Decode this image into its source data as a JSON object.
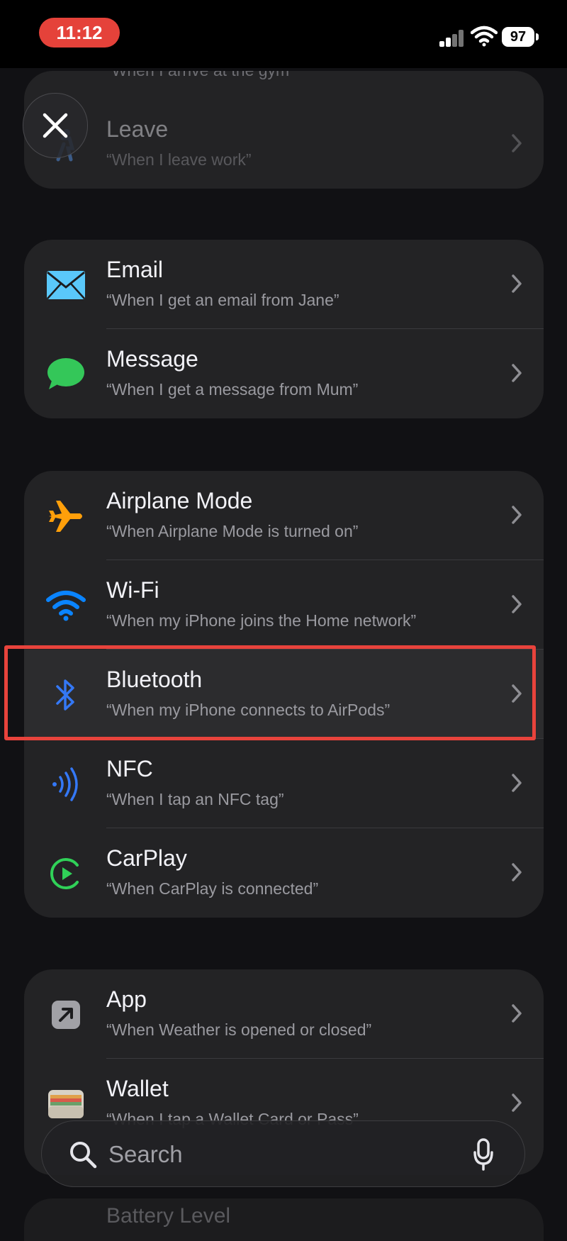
{
  "status_bar": {
    "time": "11:12",
    "battery": "97"
  },
  "groups": {
    "location": {
      "peek_text": "“When I arrive at the gym”",
      "items": [
        {
          "title": "Leave",
          "subtitle": "“When I leave work”",
          "icon": "person-walking-icon"
        }
      ]
    },
    "communication": {
      "items": [
        {
          "title": "Email",
          "subtitle": "“When I get an email from Jane”",
          "icon": "envelope-icon",
          "color": "#5ac8fa"
        },
        {
          "title": "Message",
          "subtitle": "“When I get a message from Mum”",
          "icon": "message-bubble-icon",
          "color": "#34c759"
        }
      ]
    },
    "connectivity": {
      "items": [
        {
          "title": "Airplane Mode",
          "subtitle": "“When Airplane Mode is turned on”",
          "icon": "airplane-icon",
          "color": "#ff9f0a"
        },
        {
          "title": "Wi-Fi",
          "subtitle": "“When my iPhone joins the Home network”",
          "icon": "wifi-icon",
          "color": "#0a84ff"
        },
        {
          "title": "Bluetooth",
          "subtitle": "“When my iPhone connects to AirPods”",
          "icon": "bluetooth-icon",
          "color": "#3478f6"
        },
        {
          "title": "NFC",
          "subtitle": "“When I tap an NFC tag”",
          "icon": "nfc-icon",
          "color": "#3478f6"
        },
        {
          "title": "CarPlay",
          "subtitle": "“When CarPlay is connected”",
          "icon": "carplay-icon",
          "color": "#30d158"
        }
      ]
    },
    "apps": {
      "items": [
        {
          "title": "App",
          "subtitle": "“When Weather is opened or closed”",
          "icon": "app-arrow-icon"
        },
        {
          "title": "Wallet",
          "subtitle": "“When I tap a Wallet Card or Pass”",
          "icon": "wallet-icon"
        }
      ]
    },
    "battery_peek": "Battery Level"
  },
  "search": {
    "placeholder": "Search"
  },
  "accent": {
    "highlight": "#e8433c",
    "time_pill": "#e5423a"
  }
}
